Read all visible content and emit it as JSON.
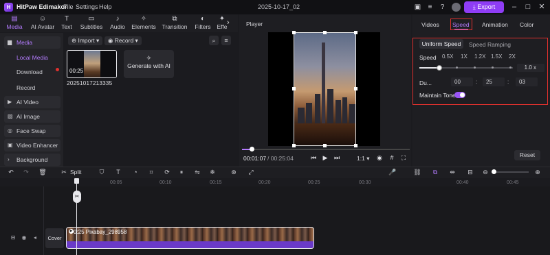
{
  "app": {
    "name": "HitPaw Edimakor",
    "menu": [
      "File",
      "Settings",
      "Help"
    ],
    "project_title": "2025-10-17_02",
    "export_label": "Export"
  },
  "tools": {
    "tabs": [
      {
        "label": "Media",
        "icon": "media-icon"
      },
      {
        "label": "AI Avatar",
        "icon": "ai-avatar-icon"
      },
      {
        "label": "Text",
        "icon": "text-icon"
      },
      {
        "label": "Subtitles",
        "icon": "subtitles-icon"
      },
      {
        "label": "Audio",
        "icon": "audio-icon"
      },
      {
        "label": "Elements",
        "icon": "elements-icon"
      },
      {
        "label": "Transition",
        "icon": "transition-icon"
      },
      {
        "label": "Filters",
        "icon": "filters-icon"
      },
      {
        "label": "Effe",
        "icon": "effects-icon"
      }
    ]
  },
  "sidebar": {
    "items": [
      {
        "label": "Media"
      },
      {
        "label": "Local Media"
      },
      {
        "label": "Download"
      },
      {
        "label": "Record"
      },
      {
        "label": "AI Video"
      },
      {
        "label": "AI Image"
      },
      {
        "label": "Face Swap"
      },
      {
        "label": "Video Enhancer"
      },
      {
        "label": "Background"
      }
    ]
  },
  "media": {
    "import_label": "Import",
    "record_label": "Record",
    "clip_duration": "00:25",
    "clip_name": "20251017213335",
    "generate_ai_label": "Generate with AI"
  },
  "player": {
    "label": "Player",
    "current_time": "00:01:07",
    "total_time": "/ 00:25:04",
    "ratio": "1:1",
    "progress_fraction": 0.05
  },
  "right_panel": {
    "tabs": [
      "Videos",
      "Speed",
      "Animation",
      "Color"
    ],
    "sub_tabs": [
      "Uniform Speed",
      "Speed Ramping"
    ],
    "speed_label": "Speed",
    "speed_marks": [
      "0.5X",
      "1X",
      "1.2X",
      "1.5X",
      "2X"
    ],
    "speed_value": "1.0 x",
    "speed_fraction": 0.2,
    "duration_label": "Du...",
    "duration": [
      "00",
      "25",
      "03"
    ],
    "maintain_tone_label": "Maintain Tone",
    "maintain_tone_on": true,
    "reset_label": "Reset"
  },
  "timeline": {
    "split_label": "Split",
    "ruler": [
      "00:05",
      "00:10",
      "00:15",
      "00:20",
      "00:25",
      "00:30",
      "00:40",
      "00:45"
    ],
    "cover_label": "Cover",
    "clip_label": "0:25 Pixabay_298958"
  },
  "colors": {
    "accent": "#8f3df5",
    "highlight_box": "#e0312e"
  }
}
